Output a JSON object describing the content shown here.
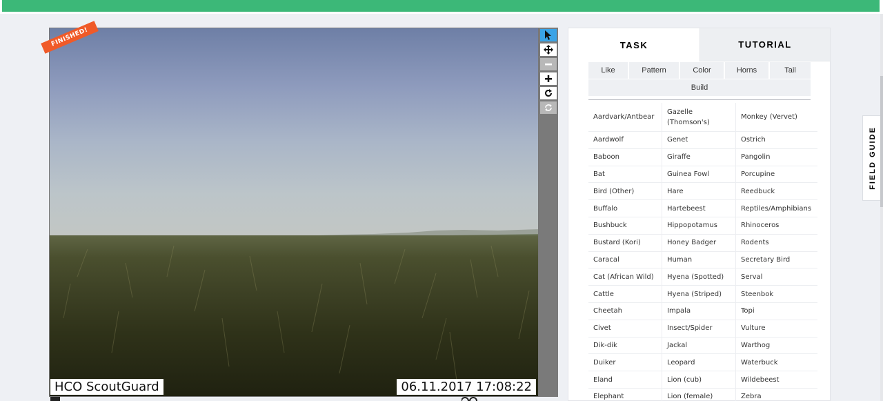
{
  "viewer": {
    "badge": "FINISHED!",
    "camera_label": "HCO ScoutGuard",
    "timestamp": "06.11.2017  17:08:22",
    "tools": [
      {
        "name": "select-pointer-icon",
        "glyph": "➤",
        "state": "active"
      },
      {
        "name": "pan-move-icon",
        "glyph": "✥",
        "state": "normal"
      },
      {
        "name": "zoom-out-icon",
        "glyph": "−",
        "state": "disabled"
      },
      {
        "name": "zoom-in-icon",
        "glyph": "+",
        "state": "normal"
      },
      {
        "name": "rotate-icon",
        "glyph": "↻",
        "state": "normal"
      },
      {
        "name": "reset-icon",
        "glyph": "⟳",
        "state": "disabled"
      }
    ]
  },
  "panel": {
    "tabs": {
      "task": "TASK",
      "tutorial": "TUTORIAL"
    },
    "filters": [
      "Like",
      "Pattern",
      "Color",
      "Horns",
      "Tail",
      "Build"
    ],
    "species": [
      [
        "Aardvark/Antbear",
        "Gazelle (Thomson's)",
        "Monkey (Vervet)"
      ],
      [
        "Aardwolf",
        "Genet",
        "Ostrich"
      ],
      [
        "Baboon",
        "Giraffe",
        "Pangolin"
      ],
      [
        "Bat",
        "Guinea Fowl",
        "Porcupine"
      ],
      [
        "Bird (Other)",
        "Hare",
        "Reedbuck"
      ],
      [
        "Buffalo",
        "Hartebeest",
        "Reptiles/Amphibians"
      ],
      [
        "Bushbuck",
        "Hippopotamus",
        "Rhinoceros"
      ],
      [
        "Bustard (Kori)",
        "Honey Badger",
        "Rodents"
      ],
      [
        "Caracal",
        "Human",
        "Secretary Bird"
      ],
      [
        "Cat (African Wild)",
        "Hyena (Spotted)",
        "Serval"
      ],
      [
        "Cattle",
        "Hyena (Striped)",
        "Steenbok"
      ],
      [
        "Cheetah",
        "Impala",
        "Topi"
      ],
      [
        "Civet",
        "Insect/Spider",
        "Vulture"
      ],
      [
        "Dik-dik",
        "Jackal",
        "Warthog"
      ],
      [
        "Duiker",
        "Leopard",
        "Waterbuck"
      ],
      [
        "Eland",
        "Lion (cub)",
        "Wildebeest"
      ],
      [
        "Elephant",
        "Lion (female)",
        "Zebra"
      ]
    ]
  },
  "field_guide": {
    "label": "FIELD GUIDE"
  },
  "colors": {
    "accent_green": "#3cb878",
    "badge_orange": "#f05a28",
    "active_tool": "#3aa3e6"
  }
}
